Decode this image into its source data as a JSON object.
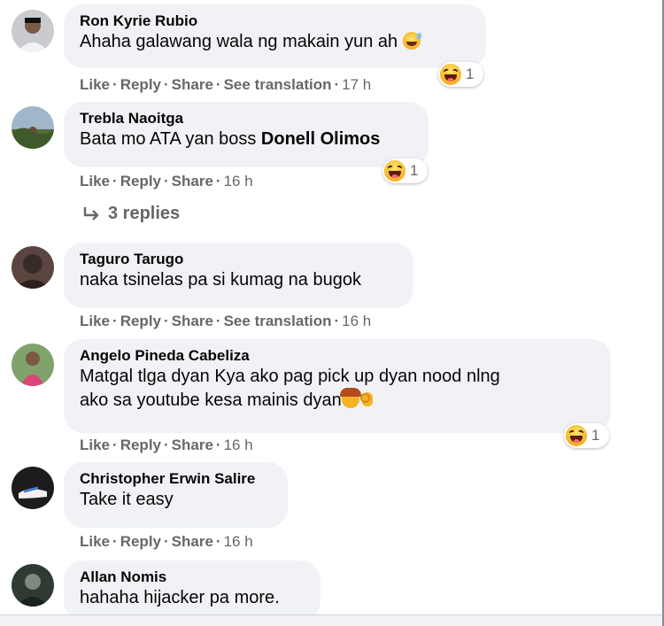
{
  "comments": [
    {
      "author": "Ron Kyrie Rubio",
      "text": "Ahaha galawang wala ng makain yun ah",
      "emoji": "grinning-sweat-emoji",
      "actions": {
        "like": "Like",
        "reply": "Reply",
        "share": "Share",
        "translate": "See translation",
        "time": "17 h"
      },
      "reaction": {
        "icon": "haha-reaction-icon",
        "count": "1"
      }
    },
    {
      "author": "Trebla Naoitga",
      "text_prefix": "Bata mo ATA yan boss ",
      "mention": "Donell Olimos",
      "actions": {
        "like": "Like",
        "reply": "Reply",
        "share": "Share",
        "time": "16 h"
      },
      "reaction": {
        "icon": "haha-reaction-icon",
        "count": "1"
      },
      "replies": "3 replies"
    },
    {
      "author": "Taguro Tarugo",
      "text": "naka tsinelas pa si kumag na bugok",
      "actions": {
        "like": "Like",
        "reply": "Reply",
        "share": "Share",
        "translate": "See translation",
        "time": "16 h"
      }
    },
    {
      "author": "Angelo Pineda Cabeliza",
      "text_line1": "Matgal tlga dyan Kya ako pag pick up dyan nood nlng",
      "text_line2": "ako sa youtube kesa mainis dyan",
      "emojis": [
        "facepalm-emoji",
        "ok-hand-emoji"
      ],
      "actions": {
        "like": "Like",
        "reply": "Reply",
        "share": "Share",
        "time": "16 h"
      },
      "reaction": {
        "icon": "haha-reaction-icon",
        "count": "1"
      }
    },
    {
      "author": "Christopher Erwin Salire",
      "text": "Take it easy",
      "actions": {
        "like": "Like",
        "reply": "Reply",
        "share": "Share",
        "time": "16 h"
      }
    },
    {
      "author": "Allan Nomis",
      "text": "hahaha hijacker pa more."
    }
  ],
  "separator": "·",
  "colors": {
    "bubble": "#f0f2f5",
    "meta": "#65676b",
    "text": "#050505",
    "haha": "#f7b125"
  }
}
